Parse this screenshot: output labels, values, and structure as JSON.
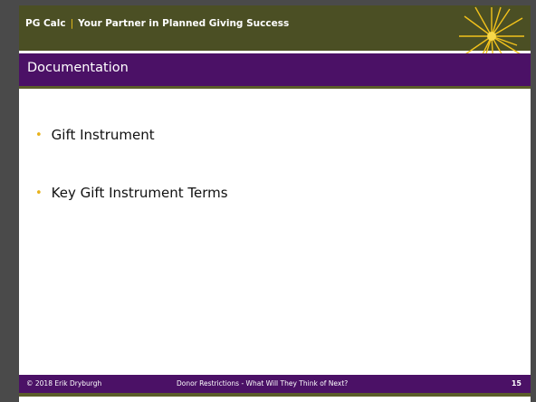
{
  "header": {
    "brand_name": "PG Calc",
    "separator": "|",
    "tagline": "Your Partner in Planned Giving Success"
  },
  "title": "Documentation",
  "bullets": [
    {
      "text": "Gift Instrument"
    },
    {
      "text": "Key Gift Instrument Terms"
    }
  ],
  "footer": {
    "copyright": "© 2018 Erik Dryburgh",
    "presentation_title": "Donor Restrictions - What Will They Think of Next?",
    "page_number": "15"
  },
  "colors": {
    "header_olive": "#4b4f24",
    "title_purple": "#4b1166",
    "accent_gold": "#f2c21b",
    "frame_gray": "#4a4a4a"
  },
  "icons": {
    "starburst": "starburst-icon",
    "bullet": "bullet-dot-icon"
  }
}
